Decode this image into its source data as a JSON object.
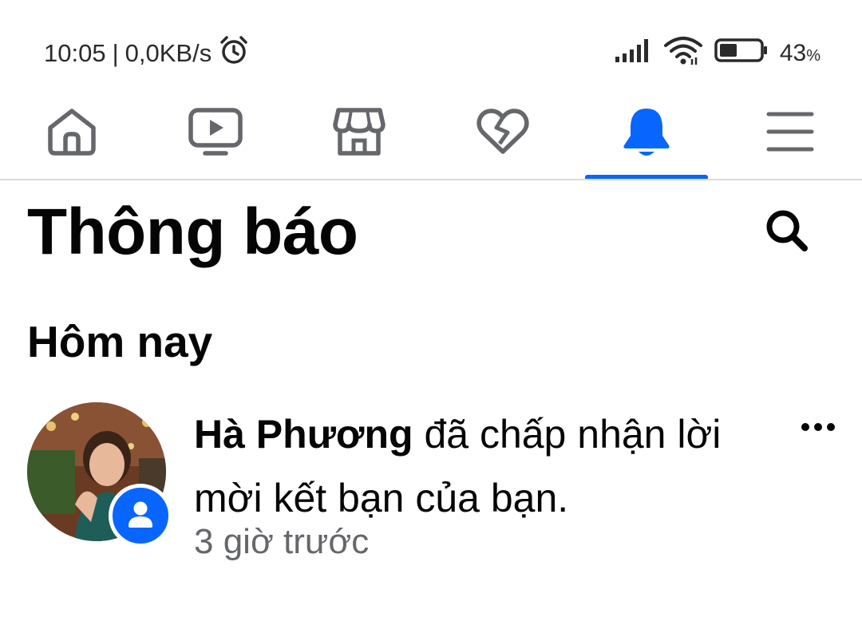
{
  "status_bar": {
    "time": "10:05",
    "separator": "|",
    "net_speed": "0,0KB/s",
    "battery_percent": "43",
    "battery_percent_sign": "%",
    "battery_level": 0.43,
    "icons": [
      "alarm-icon",
      "signal-icon",
      "wifi-icon",
      "battery-icon"
    ]
  },
  "nav": {
    "items": [
      {
        "name": "home",
        "icon": "home-icon"
      },
      {
        "name": "watch",
        "icon": "video-icon"
      },
      {
        "name": "marketplace",
        "icon": "store-icon"
      },
      {
        "name": "dating",
        "icon": "heart-icon"
      },
      {
        "name": "notifications",
        "icon": "bell-icon",
        "active": true
      },
      {
        "name": "menu",
        "icon": "hamburger-icon"
      }
    ],
    "accent_color": "#0866ff",
    "inactive_color": "#65676b"
  },
  "header": {
    "title": "Thông báo",
    "search_icon": "search-icon"
  },
  "section": {
    "title": "Hôm nay"
  },
  "notifications": [
    {
      "actor": "Hà Phương",
      "message": " đã chấp nhận lời mời kết bạn của bạn.",
      "time": "3 giờ trước",
      "badge_icon": "person-icon",
      "more_icon": "more-dots-icon"
    }
  ]
}
